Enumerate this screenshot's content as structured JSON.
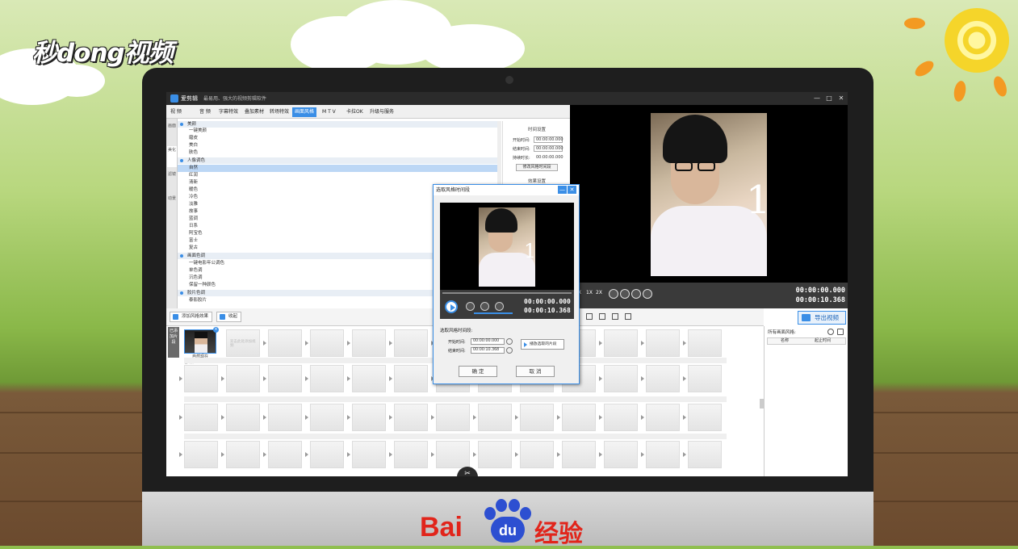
{
  "watermark": {
    "brand": "秒dong视频"
  },
  "footer_logo": {
    "bai": "Bai",
    "du": "du",
    "jingyan": "经验"
  },
  "app": {
    "title": "爱剪辑",
    "slogan": "最易用、强大的视频剪辑软件",
    "window_buttons": [
      "—",
      "□",
      "✕"
    ]
  },
  "tabs": [
    "视 频",
    "音 频",
    "字幕特效",
    "叠加素材",
    "转场特效",
    "画面风格",
    "M T V",
    "卡拉OK",
    "升级与服务"
  ],
  "active_tab_index": 5,
  "side_tabs": [
    "画面",
    "美化",
    "滤镜",
    "动景"
  ],
  "effects": {
    "categories": [
      {
        "name": "美颜",
        "items": [
          "一键美颜",
          "磨皮",
          "美白",
          "肤色"
        ]
      },
      {
        "name": "人像调色",
        "items": [
          "自然",
          "红润",
          "清新",
          "暖色",
          "冷色",
          "淡雅",
          "故事",
          "蓝调",
          "日系",
          "阿宝色",
          "富士",
          "复古"
        ]
      },
      {
        "name": "画面色调",
        "items": [
          "一键电影年公调色",
          "单色调",
          "沉色调",
          "保留一种颜色"
        ]
      },
      {
        "name": "胶片色调",
        "items": [
          "泰影胶片"
        ]
      }
    ],
    "selected_item": "自然"
  },
  "time_settings": {
    "header": "时间设置",
    "start_label": "开始时间:",
    "start_value": "00:00:00.000",
    "end_label": "结束时间:",
    "end_value": "00:00:00.000",
    "duration_label": "持续时长:",
    "duration_value": "00:00:00.000",
    "modify_button": "修改风格时间段",
    "effect_header": "效果设置"
  },
  "preview": {
    "number_overlay": "1",
    "time_current": "00:00:00.000",
    "time_total": "00:00:10.368",
    "speed_labels": [
      "X",
      "1X",
      "2X"
    ]
  },
  "export_button": "导出视频",
  "toolbar2": {
    "add_style": "添加风格效果",
    "collapse": "收起"
  },
  "clips": {
    "added_label": "已添加片段",
    "first_clip_caption": "自然现在",
    "placeholder": "双击此处添加视频",
    "audio_row_label": "音 频"
  },
  "right_panel": {
    "title": "所有画面风格:",
    "col_name": "名称",
    "col_start": "起止时间"
  },
  "dialog": {
    "title": "选取风格时间段",
    "number_overlay": "1",
    "time_current": "00:00:00.000",
    "time_total": "00:00:10.368",
    "section_label": "选取风格时间段:",
    "start_label": "开始时间:",
    "start_value": "00:00:00.000",
    "end_label": "结束时间:",
    "end_value": "00:00:10.368",
    "play_selected": "播放选取的片段",
    "ok": "确 定",
    "cancel": "取 消"
  },
  "colors": {
    "accent": "#3a8ee6",
    "baidu_red": "#e1251b",
    "baidu_blue": "#2d4fd1"
  }
}
